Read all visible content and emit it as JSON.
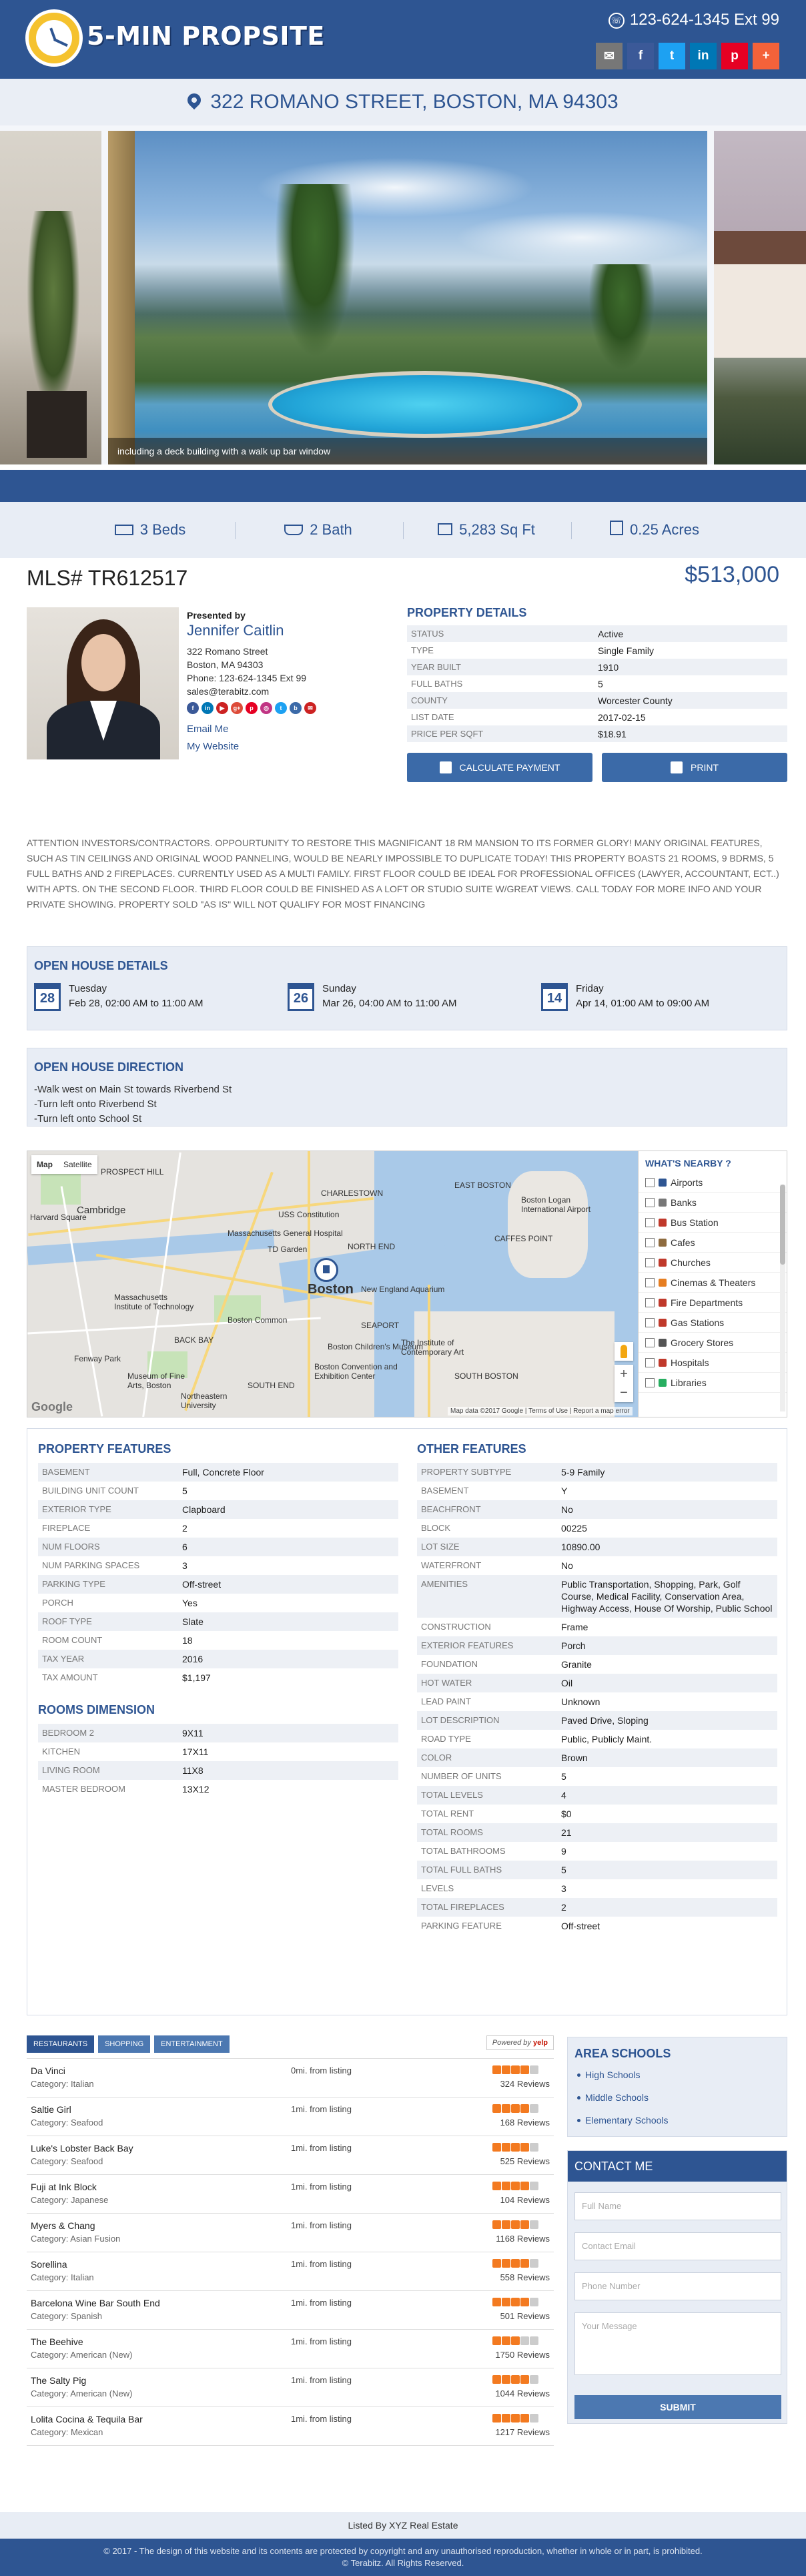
{
  "header": {
    "logo_text": "5-MIN PROPSITE",
    "phone": "123-624-1345 Ext 99",
    "social": [
      {
        "name": "email-icon",
        "glyph": "✉",
        "color": "#777777"
      },
      {
        "name": "facebook-icon",
        "glyph": "f",
        "color": "#3b5998"
      },
      {
        "name": "twitter-icon",
        "glyph": "t",
        "color": "#1da1f2"
      },
      {
        "name": "linkedin-icon",
        "glyph": "in",
        "color": "#0077b5"
      },
      {
        "name": "pinterest-icon",
        "glyph": "p",
        "color": "#e60023"
      },
      {
        "name": "plus-icon",
        "glyph": "+",
        "color": "#f4623a"
      }
    ]
  },
  "address": "322 ROMANO STREET, BOSTON, MA 94303",
  "gallery": {
    "caption": "including a deck building with a walk up bar window"
  },
  "stats": {
    "beds": "3 Beds",
    "bath": "2 Bath",
    "sqft": "5,283 Sq Ft",
    "acres": "0.25 Acres"
  },
  "mls": "MLS# TR612517",
  "price": "$513,000",
  "agent": {
    "presented_by": "Presented by",
    "name": "Jennifer Caitlin",
    "street": "322 Romano Street",
    "city": "Boston, MA 94303",
    "phone": "Phone: 123-624-1345 Ext 99",
    "email": "sales@terabitz.com",
    "email_me": "Email Me",
    "website": "My Website",
    "social": [
      {
        "name": "facebook-icon",
        "glyph": "f",
        "color": "#3b5998"
      },
      {
        "name": "linkedin-icon",
        "glyph": "in",
        "color": "#0077b5"
      },
      {
        "name": "youtube-icon",
        "glyph": "▶",
        "color": "#cc2222"
      },
      {
        "name": "google-plus-icon",
        "glyph": "g+",
        "color": "#dd4b39"
      },
      {
        "name": "pinterest-icon",
        "glyph": "p",
        "color": "#e60023"
      },
      {
        "name": "instagram-icon",
        "glyph": "◎",
        "color": "#c13584"
      },
      {
        "name": "twitter-icon",
        "glyph": "t",
        "color": "#1da1f2"
      },
      {
        "name": "blog-icon",
        "glyph": "b",
        "color": "#3b6aa8"
      },
      {
        "name": "email-icon",
        "glyph": "✉",
        "color": "#cc2222"
      }
    ]
  },
  "property_details": {
    "title": "PROPERTY DETAILS",
    "rows": [
      {
        "k": "STATUS",
        "v": "Active"
      },
      {
        "k": "TYPE",
        "v": "Single Family"
      },
      {
        "k": "YEAR BUILT",
        "v": "1910"
      },
      {
        "k": "FULL BATHS",
        "v": "5"
      },
      {
        "k": "COUNTY",
        "v": "Worcester County"
      },
      {
        "k": "LIST DATE",
        "v": "2017-02-15"
      },
      {
        "k": "PRICE PER SQFT",
        "v": "$18.91"
      }
    ],
    "calc_label": "CALCULATE PAYMENT",
    "print_label": "PRINT"
  },
  "description": "ATTENTION INVESTORS/CONTRACTORS. OPPOURTUNITY TO RESTORE THIS MAGNIFICANT 18 RM MANSION TO ITS FORMER GLORY! MANY ORIGINAL FEATURES, SUCH AS TIN CEILINGS AND ORIGINAL WOOD PANNELING, WOULD BE NEARLY IMPOSSIBLE TO DUPLICATE TODAY! THIS PROPERTY BOASTS 21 ROOMS, 9 BDRMS, 5 FULL BATHS AND 2 FIREPLACES. CURRENTLY USED AS A MULTI FAMILY. FIRST FLOOR COULD BE IDEAL FOR PROFESSIONAL OFFICES (LAWYER, ACCOUNTANT, ECT..) WITH APTS. ON THE SECOND FLOOR. THIRD FLOOR COULD BE FINISHED AS A LOFT OR STUDIO SUITE W/GREAT VIEWS. CALL TODAY FOR MORE INFO AND YOUR PRIVATE SHOWING. PROPERTY SOLD \"AS IS\" WILL NOT QUALIFY FOR MOST FINANCING",
  "open_house": {
    "title": "OPEN HOUSE DETAILS",
    "items": [
      {
        "date_num": "28",
        "day": "Tuesday",
        "time": "Feb 28, 02:00 AM to 11:00 AM"
      },
      {
        "date_num": "26",
        "day": "Sunday",
        "time": "Mar 26, 04:00 AM to 11:00 AM"
      },
      {
        "date_num": "14",
        "day": "Friday",
        "time": "Apr 14, 01:00 AM to 09:00 AM"
      }
    ]
  },
  "directions": {
    "title": "OPEN HOUSE DIRECTION",
    "lines": [
      "-Walk west on Main St towards Riverbend St",
      "-Turn left onto Riverbend St",
      "-Turn left onto School St"
    ]
  },
  "map": {
    "type_map": "Map",
    "type_satellite": "Satellite",
    "labels": {
      "cambridge": "Cambridge",
      "boston": "Boston",
      "harvard": "Harvard Square",
      "mit": "Massachusetts Institute of Technology",
      "airport": "Boston Logan International Airport",
      "aquarium": "New England Aquarium",
      "prospect_hill": "PROSPECT HILL",
      "north_end": "NORTH END",
      "back_bay": "BACK BAY",
      "south_end": "SOUTH END",
      "fenway": "Fenway Park",
      "uss": "USS Constitution",
      "td": "TD Garden",
      "eastie": "EAST BOSTON",
      "charlestown": "CHARLESTOWN",
      "seaport": "SEAPORT",
      "mfa": "Museum of Fine Arts, Boston",
      "northeastern": "Northeastern University",
      "ica": "The Institute of Contemporary Art",
      "convention": "Boston Convention and Exhibition Center",
      "childrens": "Boston Children's Museum",
      "mgh": "Massachusetts General Hospital",
      "common": "Boston Common",
      "south_boston": "SOUTH BOSTON",
      "cafe_point": "CAFFES POINT"
    },
    "google": "Google",
    "attribution": "Map data ©2017 Google  |  Terms of Use  |  Report a map error",
    "nearby_title": "WHAT'S NEARBY ?",
    "nearby": [
      {
        "label": "Airports",
        "icon": "airport-icon",
        "color": "#2e5592"
      },
      {
        "label": "Banks",
        "icon": "bank-icon",
        "color": "#777777"
      },
      {
        "label": "Bus Station",
        "icon": "bus-icon",
        "color": "#c0392b"
      },
      {
        "label": "Cafes",
        "icon": "cafe-icon",
        "color": "#8e6b3f"
      },
      {
        "label": "Churches",
        "icon": "church-icon",
        "color": "#c0392b"
      },
      {
        "label": "Cinemas & Theaters",
        "icon": "cinema-icon",
        "color": "#e67e22"
      },
      {
        "label": "Fire Departments",
        "icon": "fire-icon",
        "color": "#c0392b"
      },
      {
        "label": "Gas Stations",
        "icon": "gas-icon",
        "color": "#c0392b"
      },
      {
        "label": "Grocery Stores",
        "icon": "grocery-icon",
        "color": "#555555"
      },
      {
        "label": "Hospitals",
        "icon": "hospital-icon",
        "color": "#c0392b"
      },
      {
        "label": "Libraries",
        "icon": "library-icon",
        "color": "#27ae60"
      }
    ]
  },
  "features": {
    "property_title": "PROPERTY FEATURES",
    "property_rows": [
      {
        "k": "BASEMENT",
        "v": "Full, Concrete Floor"
      },
      {
        "k": "BUILDING UNIT COUNT",
        "v": "5"
      },
      {
        "k": "EXTERIOR TYPE",
        "v": "Clapboard"
      },
      {
        "k": "FIREPLACE",
        "v": "2"
      },
      {
        "k": "NUM FLOORS",
        "v": "6"
      },
      {
        "k": "NUM PARKING SPACES",
        "v": "3"
      },
      {
        "k": "PARKING TYPE",
        "v": "Off-street"
      },
      {
        "k": "PORCH",
        "v": "Yes"
      },
      {
        "k": "ROOF TYPE",
        "v": "Slate"
      },
      {
        "k": "ROOM COUNT",
        "v": "18"
      },
      {
        "k": "TAX YEAR",
        "v": "2016"
      },
      {
        "k": "TAX AMOUNT",
        "v": "$1,197"
      }
    ],
    "rooms_title": "ROOMS DIMENSION",
    "rooms_rows": [
      {
        "k": "BEDROOM 2",
        "v": "9X11"
      },
      {
        "k": "KITCHEN",
        "v": "17X11"
      },
      {
        "k": "LIVING ROOM",
        "v": "11X8"
      },
      {
        "k": "MASTER BEDROOM",
        "v": "13X12"
      }
    ],
    "other_title": "OTHER FEATURES",
    "other_rows": [
      {
        "k": "PROPERTY SUBTYPE",
        "v": "5-9 Family"
      },
      {
        "k": "BASEMENT",
        "v": "Y"
      },
      {
        "k": "BEACHFRONT",
        "v": "No"
      },
      {
        "k": "BLOCK",
        "v": "00225"
      },
      {
        "k": "LOT SIZE",
        "v": "10890.00"
      },
      {
        "k": "WATERFRONT",
        "v": "No"
      },
      {
        "k": "AMENITIES",
        "v": "Public Transportation, Shopping, Park, Golf Course, Medical Facility, Conservation Area, Highway Access, House Of Worship, Public School"
      },
      {
        "k": "CONSTRUCTION",
        "v": "Frame"
      },
      {
        "k": "EXTERIOR FEATURES",
        "v": "Porch"
      },
      {
        "k": "FOUNDATION",
        "v": "Granite"
      },
      {
        "k": "HOT WATER",
        "v": "Oil"
      },
      {
        "k": "LEAD PAINT",
        "v": "Unknown"
      },
      {
        "k": "LOT DESCRIPTION",
        "v": "Paved Drive, Sloping"
      },
      {
        "k": "ROAD TYPE",
        "v": "Public, Publicly Maint."
      },
      {
        "k": "COLOR",
        "v": "Brown"
      },
      {
        "k": "NUMBER OF UNITS",
        "v": "5"
      },
      {
        "k": "TOTAL LEVELS",
        "v": "4"
      },
      {
        "k": "TOTAL RENT",
        "v": "$0"
      },
      {
        "k": "TOTAL ROOMS",
        "v": "21"
      },
      {
        "k": "TOTAL BATHROOMS",
        "v": "9"
      },
      {
        "k": "TOTAL FULL BATHS",
        "v": "5"
      },
      {
        "k": "LEVELS",
        "v": "3"
      },
      {
        "k": "TOTAL FIREPLACES",
        "v": "2"
      },
      {
        "k": "PARKING FEATURE",
        "v": "Off-street"
      }
    ]
  },
  "restaurants": {
    "tabs": [
      "RESTAURANTS",
      "SHOPPING",
      "ENTERTAINMENT"
    ],
    "powered_by": "Powered by",
    "yelp": "yelp",
    "items": [
      {
        "name": "Da Vinci",
        "category": "Category: Italian",
        "distance": "0mi. from listing",
        "stars": 4,
        "reviews": "324 Reviews"
      },
      {
        "name": "Saltie Girl",
        "category": "Category: Seafood",
        "distance": "1mi. from listing",
        "stars": 4,
        "reviews": "168 Reviews"
      },
      {
        "name": "Luke's Lobster Back Bay",
        "category": "Category: Seafood",
        "distance": "1mi. from listing",
        "stars": 4,
        "reviews": "525 Reviews"
      },
      {
        "name": "Fuji at Ink Block",
        "category": "Category: Japanese",
        "distance": "1mi. from listing",
        "stars": 4,
        "reviews": "104 Reviews"
      },
      {
        "name": "Myers & Chang",
        "category": "Category: Asian Fusion",
        "distance": "1mi. from listing",
        "stars": 4,
        "reviews": "1168 Reviews"
      },
      {
        "name": "Sorellina",
        "category": "Category: Italian",
        "distance": "1mi. from listing",
        "stars": 4,
        "reviews": "558 Reviews"
      },
      {
        "name": "Barcelona Wine Bar South End",
        "category": "Category: Spanish",
        "distance": "1mi. from listing",
        "stars": 4,
        "reviews": "501 Reviews"
      },
      {
        "name": "The Beehive",
        "category": "Category: American (New)",
        "distance": "1mi. from listing",
        "stars": 3,
        "reviews": "1750 Reviews"
      },
      {
        "name": "The Salty Pig",
        "category": "Category: American (New)",
        "distance": "1mi. from listing",
        "stars": 4,
        "reviews": "1044 Reviews"
      },
      {
        "name": "Lolita Cocina & Tequila Bar",
        "category": "Category: Mexican",
        "distance": "1mi. from listing",
        "stars": 4,
        "reviews": "1217 Reviews"
      }
    ]
  },
  "schools": {
    "title": "AREA SCHOOLS",
    "items": [
      "High Schools",
      "Middle Schools",
      "Elementary Schools"
    ]
  },
  "contact": {
    "title": "CONTACT ME",
    "full_name": "Full Name",
    "email": "Contact Email",
    "phone": "Phone Number",
    "message": "Your Message",
    "submit": "SUBMIT"
  },
  "listed_by": "Listed By XYZ Real Estate",
  "footer": {
    "line1": "© 2017 - The design of this website and its contents are protected by copyright and any unauthorised reproduction, whether in whole or in part, is prohibited.",
    "line2": "© Terabitz. All Rights Reserved."
  }
}
